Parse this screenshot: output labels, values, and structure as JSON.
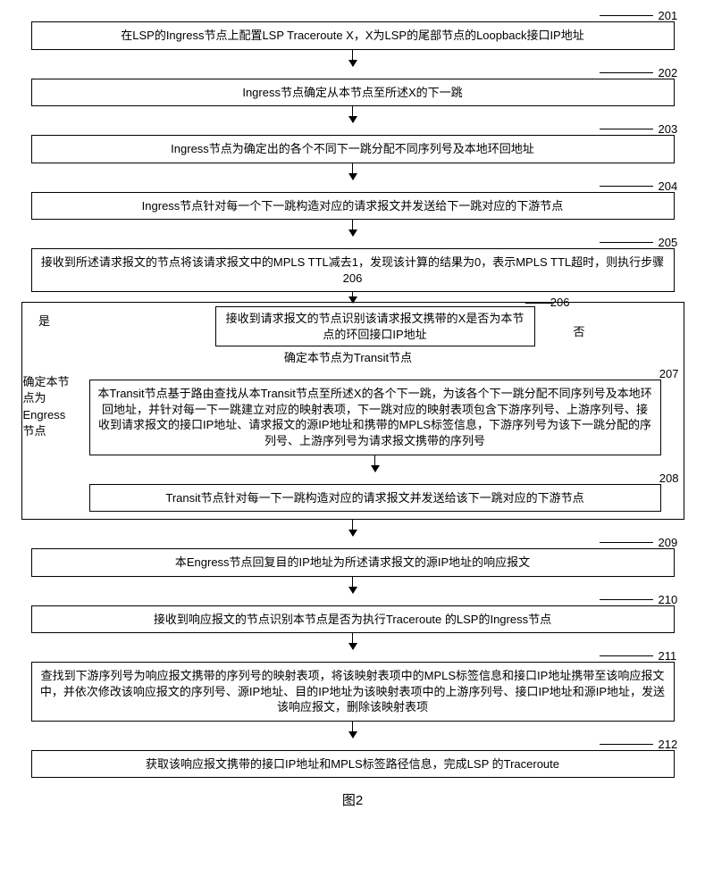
{
  "steps": {
    "s201": {
      "num": "201",
      "text": "在LSP的Ingress节点上配置LSP Traceroute X，X为LSP的尾部节点的Loopback接口IP地址"
    },
    "s202": {
      "num": "202",
      "text": "Ingress节点确定从本节点至所述X的下一跳"
    },
    "s203": {
      "num": "203",
      "text": "Ingress节点为确定出的各个不同下一跳分配不同序列号及本地环回地址"
    },
    "s204": {
      "num": "204",
      "text": "Ingress节点针对每一个下一跳构造对应的请求报文并发送给下一跳对应的下游节点"
    },
    "s205": {
      "num": "205",
      "text": "接收到所述请求报文的节点将该请求报文中的MPLS TTL减去1，发现该计算的结果为0，表示MPLS TTL超时，则执行步骤206"
    },
    "s206": {
      "num": "206",
      "text": "接收到请求报文的节点识别该请求报文携带的X是否为本节点的环回接口IP地址"
    },
    "s207": {
      "num": "207",
      "text": "本Transit节点基于路由查找从本Transit节点至所述X的各个下一跳，为该各个下一跳分配不同序列号及本地环回地址，并针对每一下一跳建立对应的映射表项，下一跳对应的映射表项包含下游序列号、上游序列号、接收到请求报文的接口IP地址、请求报文的源IP地址和携带的MPLS标签信息，下游序列号为该下一跳分配的序列号、上游序列号为请求报文携带的序列号"
    },
    "s208": {
      "num": "208",
      "text": "Transit节点针对每一下一跳构造对应的请求报文并发送给该下一跳对应的下游节点"
    },
    "s209": {
      "num": "209",
      "text": "本Engress节点回复目的IP地址为所述请求报文的源IP地址的响应报文"
    },
    "s210": {
      "num": "210",
      "text": "接收到响应报文的节点识别本节点是否为执行Traceroute 的LSP的Ingress节点"
    },
    "s211": {
      "num": "211",
      "text": "查找到下游序列号为响应报文携带的序列号的映射表项，将该映射表项中的MPLS标签信息和接口IP地址携带至该响应报文中，并依次修改该响应报文的序列号、源IP地址、目的IP地址为该映射表项中的上游序列号、接口IP地址和源IP地址，发送该响应报文，删除该映射表项"
    },
    "s212": {
      "num": "212",
      "text": "获取该响应报文携带的接口IP地址和MPLS标签路径信息，完成LSP 的Traceroute"
    }
  },
  "labels": {
    "yes": "是",
    "no": "否",
    "transit": "确定本节点为Transit节点",
    "engress_line1": "确定本节",
    "engress_line2": "点为",
    "engress_line3": "Engress",
    "engress_line4": "节点"
  },
  "figure": "图2",
  "chart_data": {
    "type": "flowchart",
    "title": "图2",
    "nodes": [
      {
        "id": "201",
        "label": "在LSP的Ingress节点上配置LSP Traceroute X，X为LSP的尾部节点的Loopback接口IP地址",
        "type": "process"
      },
      {
        "id": "202",
        "label": "Ingress节点确定从本节点至所述X的下一跳",
        "type": "process"
      },
      {
        "id": "203",
        "label": "Ingress节点为确定出的各个不同下一跳分配不同序列号及本地环回地址",
        "type": "process"
      },
      {
        "id": "204",
        "label": "Ingress节点针对每一个下一跳构造对应的请求报文并发送给下一跳对应的下游节点",
        "type": "process"
      },
      {
        "id": "205",
        "label": "接收到所述请求报文的节点将该请求报文中的MPLS TTL减去1，发现该计算的结果为0，表示MPLS TTL超时，则执行步骤206",
        "type": "process"
      },
      {
        "id": "206",
        "label": "接收到请求报文的节点识别该请求报文携带的X是否为本节点的环回接口IP地址",
        "type": "decision"
      },
      {
        "id": "207",
        "label": "本Transit节点基于路由查找从本Transit节点至所述X的各个下一跳，为该各个下一跳分配不同序列号及本地环回地址，并针对每一下一跳建立对应的映射表项，下一跳对应的映射表项包含下游序列号、上游序列号、接收到请求报文的接口IP地址、请求报文的源IP地址和携带的MPLS标签信息，下游序列号为该下一跳分配的序列号、上游序列号为请求报文携带的序列号",
        "type": "process"
      },
      {
        "id": "208",
        "label": "Transit节点针对每一下一跳构造对应的请求报文并发送给该下一跳对应的下游节点",
        "type": "process"
      },
      {
        "id": "209",
        "label": "本Engress节点回复目的IP地址为所述请求报文的源IP地址的响应报文",
        "type": "process"
      },
      {
        "id": "210",
        "label": "接收到响应报文的节点识别本节点是否为执行Traceroute 的LSP的Ingress节点",
        "type": "process"
      },
      {
        "id": "211",
        "label": "查找到下游序列号为响应报文携带的序列号的映射表项，将该映射表项中的MPLS标签信息和接口IP地址携带至该响应报文中，并依次修改该响应报文的序列号、源IP地址、目的IP地址为该映射表项中的上游序列号、接口IP地址和源IP地址，发送该响应报文，删除该映射表项",
        "type": "process"
      },
      {
        "id": "212",
        "label": "获取该响应报文携带的接口IP地址和MPLS标签路径信息，完成LSP 的Traceroute",
        "type": "process"
      }
    ],
    "edges": [
      {
        "from": "201",
        "to": "202"
      },
      {
        "from": "202",
        "to": "203"
      },
      {
        "from": "203",
        "to": "204"
      },
      {
        "from": "204",
        "to": "205"
      },
      {
        "from": "205",
        "to": "206"
      },
      {
        "from": "206",
        "to": "207",
        "label": "否 / 确定本节点为Transit节点"
      },
      {
        "from": "207",
        "to": "208"
      },
      {
        "from": "206",
        "to": "209",
        "label": "是 / 确定本节点为Engress节点"
      },
      {
        "from": "209",
        "to": "210"
      },
      {
        "from": "210",
        "to": "211"
      },
      {
        "from": "211",
        "to": "212"
      }
    ]
  }
}
